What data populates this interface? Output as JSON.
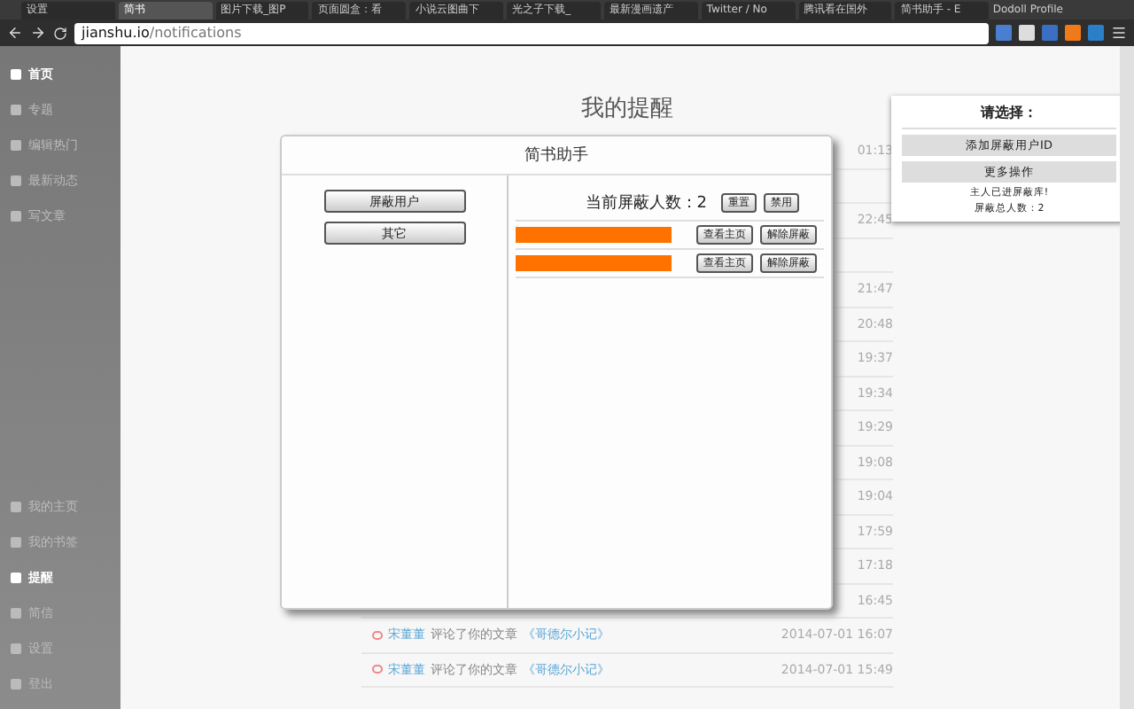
{
  "browser": {
    "tabs": [
      {
        "title": "设置",
        "selected": false
      },
      {
        "title": "简书",
        "selected": true
      },
      {
        "title": "图片下载_图P",
        "selected": false
      },
      {
        "title": "页面圆盒：看",
        "selected": false
      },
      {
        "title": "小说云图曲下",
        "selected": false
      },
      {
        "title": "光之子下载_",
        "selected": false
      },
      {
        "title": "最新漫画遗产",
        "selected": false
      },
      {
        "title": "Twitter / No",
        "selected": false
      },
      {
        "title": "腾讯看在国外",
        "selected": false
      },
      {
        "title": "简书助手 - E",
        "selected": false
      }
    ],
    "profile": "Dodoll Profile",
    "url_host": "jianshu.io",
    "url_path": "/notifications"
  },
  "sidebar": {
    "top": [
      {
        "label": "首页",
        "selected": true
      },
      {
        "label": "专题",
        "selected": false
      },
      {
        "label": "编辑热门",
        "selected": false
      },
      {
        "label": "最新动态",
        "selected": false
      },
      {
        "label": "写文章",
        "selected": false
      }
    ],
    "bottom": [
      {
        "label": "我的主页",
        "selected": false
      },
      {
        "label": "我的书签",
        "selected": false
      },
      {
        "label": "提醒",
        "selected": true
      },
      {
        "label": "简信",
        "selected": false
      },
      {
        "label": "设置",
        "selected": false
      },
      {
        "label": "登出",
        "selected": false
      }
    ]
  },
  "page_title": "我的提醒",
  "notifications": [
    {
      "kind": "time",
      "time": "01:13"
    },
    {
      "kind": "hidden"
    },
    {
      "kind": "time",
      "time": "22:45"
    },
    {
      "kind": "hidden"
    },
    {
      "kind": "time",
      "time": "21:47"
    },
    {
      "kind": "time",
      "time": "20:48"
    },
    {
      "kind": "time",
      "time": "19:37"
    },
    {
      "kind": "time",
      "time": "19:34"
    },
    {
      "kind": "time",
      "time": "19:29"
    },
    {
      "kind": "time",
      "time": "19:08"
    },
    {
      "kind": "time",
      "time": "19:04"
    },
    {
      "kind": "time",
      "time": "17:59"
    },
    {
      "kind": "time",
      "time": "17:18"
    },
    {
      "kind": "time",
      "time": "16:45"
    },
    {
      "kind": "comment",
      "user": "宋董董",
      "action": "评论了你的文章",
      "article": "《哥德尔小记》",
      "time": "2014-07-01 16:07"
    },
    {
      "kind": "comment",
      "user": "宋董董",
      "action": "评论了你的文章",
      "article": "《哥德尔小记》",
      "time": "2014-07-01 15:49"
    }
  ],
  "dialog": {
    "title": "简书助手",
    "menu": [
      "屏蔽用户",
      "其它"
    ],
    "count_label": "当前屏蔽人数：2",
    "actions": [
      "重置",
      "禁用"
    ],
    "blocked": [
      {
        "buttons": [
          "查看主页",
          "解除屏蔽"
        ]
      },
      {
        "buttons": [
          "查看主页",
          "解除屏蔽"
        ]
      }
    ]
  },
  "popup": {
    "title": "请选择：",
    "buttons": [
      "添加屏蔽用户ID",
      "更多操作"
    ],
    "status": [
      "主人已进屏蔽库!",
      "屏蔽总人数：2"
    ]
  }
}
